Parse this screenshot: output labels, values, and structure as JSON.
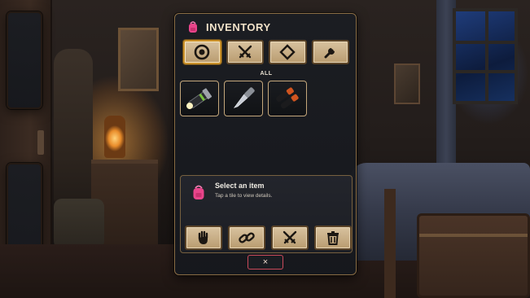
{
  "inventory": {
    "title": "INVENTORY",
    "icon": "backpack-icon",
    "accent_color": "#e8458b",
    "tabs": [
      {
        "icon": "target-icon",
        "active": true
      },
      {
        "icon": "crossed-swords-icon",
        "active": false
      },
      {
        "icon": "diamond-icon",
        "active": false
      },
      {
        "icon": "wrench-icon",
        "active": false
      }
    ],
    "section_label": "ALL",
    "items": [
      {
        "icon": "flashlight-icon"
      },
      {
        "icon": "knife-icon"
      },
      {
        "icon": "batteries-icon"
      }
    ],
    "details": {
      "icon": "backpack-icon",
      "title": "Select an item",
      "subtitle": "Tap a tile to view details."
    },
    "actions": [
      {
        "icon": "hand-icon"
      },
      {
        "icon": "chain-link-icon"
      },
      {
        "icon": "crossed-swords-icon"
      },
      {
        "icon": "trash-icon"
      }
    ],
    "close_label": "×"
  }
}
